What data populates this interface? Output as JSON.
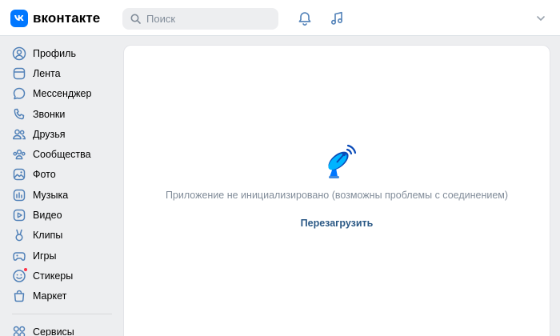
{
  "brand": {
    "name": "вконтакте",
    "color": "#0077ff"
  },
  "search": {
    "placeholder": "Поиск"
  },
  "header": {
    "icons": [
      "bell-icon",
      "music-icon",
      "chevron-down-icon"
    ]
  },
  "sidebar": {
    "items": [
      {
        "label": "Профиль",
        "icon": "profile-icon"
      },
      {
        "label": "Лента",
        "icon": "feed-icon"
      },
      {
        "label": "Мессенджер",
        "icon": "messenger-icon"
      },
      {
        "label": "Звонки",
        "icon": "phone-icon"
      },
      {
        "label": "Друзья",
        "icon": "friends-icon"
      },
      {
        "label": "Сообщества",
        "icon": "communities-icon"
      },
      {
        "label": "Фото",
        "icon": "photo-icon"
      },
      {
        "label": "Музыка",
        "icon": "music-icon"
      },
      {
        "label": "Видео",
        "icon": "video-icon"
      },
      {
        "label": "Клипы",
        "icon": "clips-icon"
      },
      {
        "label": "Игры",
        "icon": "games-icon"
      },
      {
        "label": "Стикеры",
        "icon": "stickers-icon",
        "badge_dot": true
      },
      {
        "label": "Маркет",
        "icon": "market-icon"
      },
      {
        "label": "Сервисы",
        "icon": "services-icon"
      }
    ]
  },
  "main": {
    "message": "Приложение не инициализировано (возможны проблемы с соединением)",
    "reload_label": "Перезагрузить",
    "illustration": "satellite-dish-icon"
  },
  "colors": {
    "accent": "#0077ff",
    "link": "#2a5885",
    "muted": "#818c99",
    "icon": "#5181b8",
    "background": "#edeef0",
    "notification_dot": "#ff3347"
  }
}
